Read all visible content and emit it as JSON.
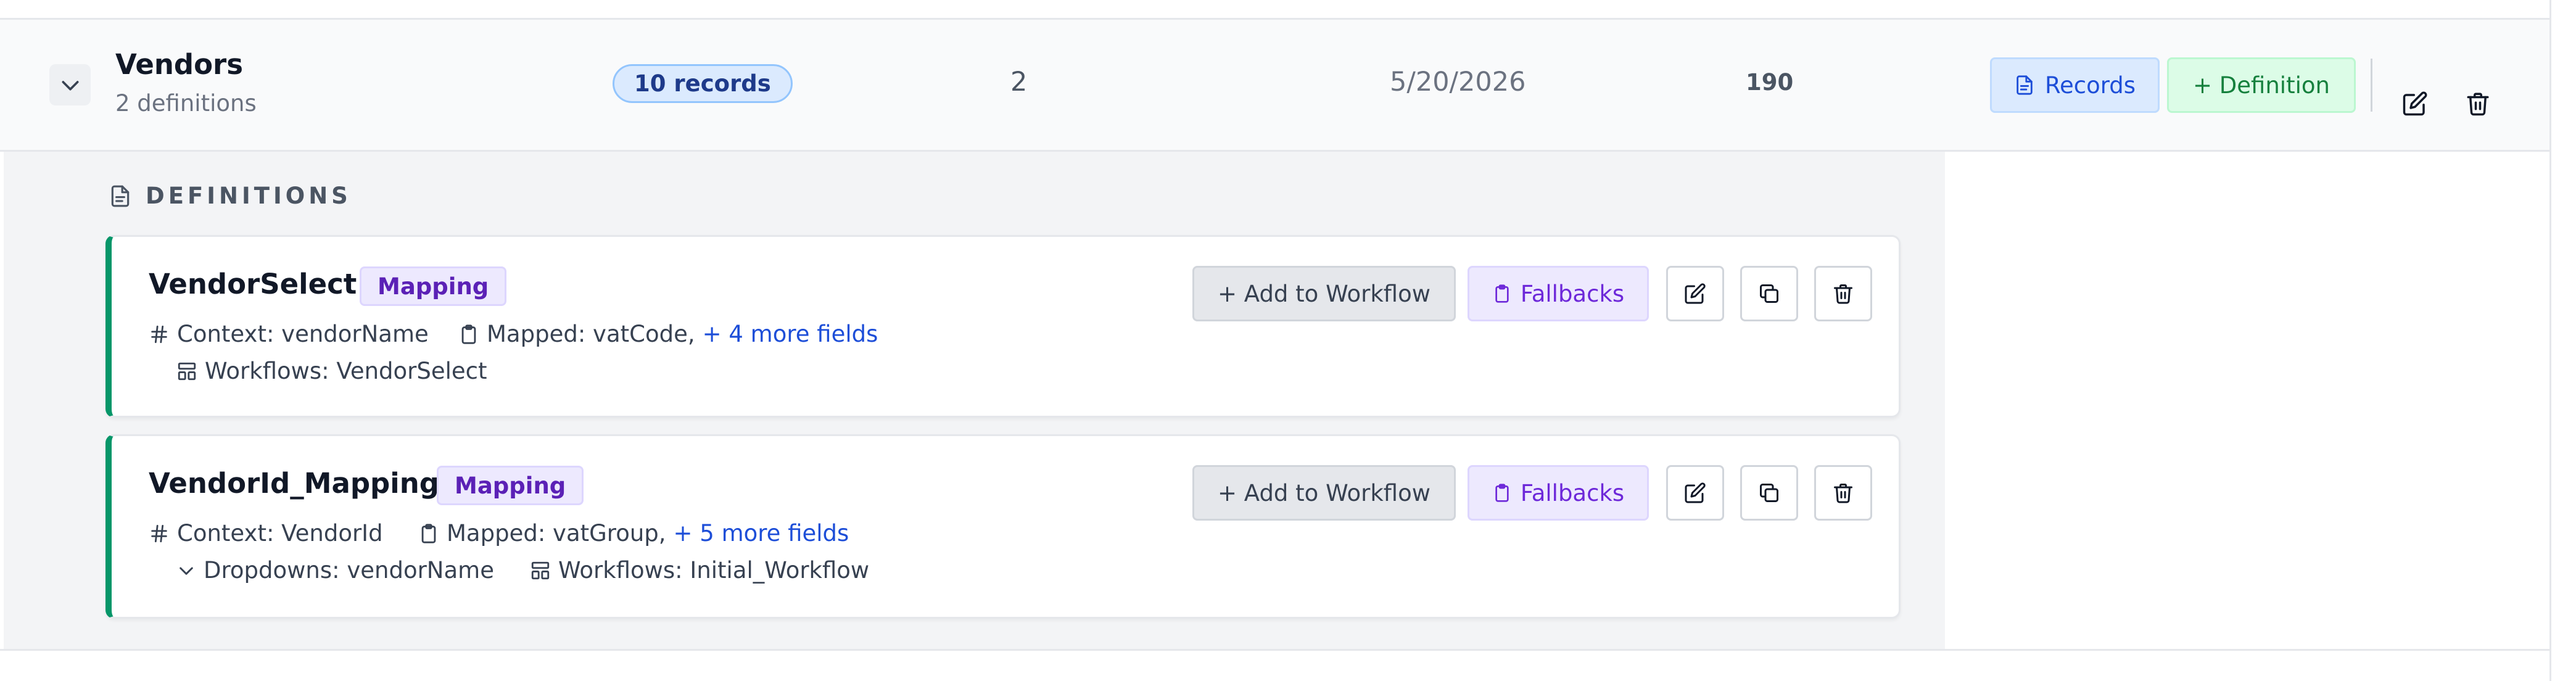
{
  "vendor": {
    "name": "Vendors",
    "definitions_count": "2 definitions",
    "records_badge": "10 records",
    "col_count": "2",
    "date": "5/20/2026",
    "col_number": "190",
    "records_button": "Records",
    "definition_button": "+ Definition"
  },
  "definitions_header": "DEFINITIONS",
  "cards": [
    {
      "title": "VendorSelect",
      "tag": "Mapping",
      "context": "Context: vendorName",
      "mapped": "Mapped: vatCode,",
      "more_fields": "+ 4 more fields",
      "workflows": "Workflows: VendorSelect",
      "add_label": "+ Add to Workflow",
      "fallbacks_label": "Fallbacks"
    },
    {
      "title": "VendorId_Mapping",
      "tag": "Mapping",
      "context": "Context: VendorId",
      "mapped": "Mapped: vatGroup,",
      "more_fields": "+ 5 more fields",
      "dropdowns": "Dropdowns: vendorName",
      "workflows": "Workflows: Initial_Workflow",
      "add_label": "+ Add to Workflow",
      "fallbacks_label": "Fallbacks"
    }
  ],
  "colors": {
    "accent_green": "#059669",
    "records_blue": "#1d4ed8",
    "definition_green": "#15803d",
    "mapping_purple": "#5b21b6"
  },
  "icons": [
    "chevron-down-icon",
    "document-icon",
    "pencil-icon",
    "trash-icon",
    "hash-icon",
    "clipboard-icon",
    "layout-icon",
    "copy-icon"
  ]
}
